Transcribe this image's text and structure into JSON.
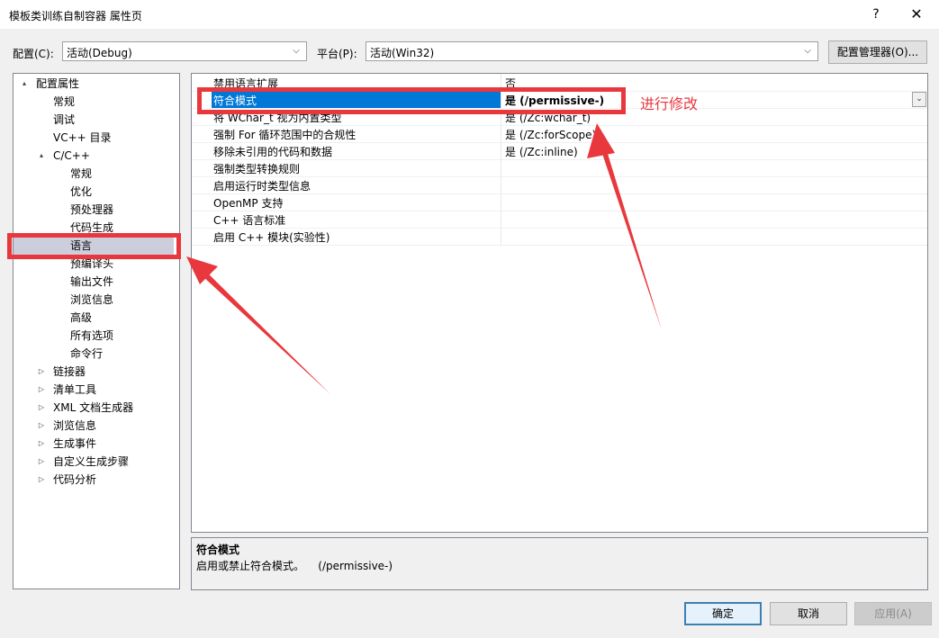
{
  "window": {
    "title": "模板类训练自制容器 属性页",
    "help_glyph": "?",
    "close_glyph": "✕"
  },
  "config_bar": {
    "config_label": "配置(C):",
    "config_value": "活动(Debug)",
    "platform_label": "平台(P):",
    "platform_value": "活动(Win32)",
    "manager_button": "配置管理器(O)..."
  },
  "tree": {
    "items": [
      {
        "label": "配置属性",
        "expand": "▴",
        "depth": 0
      },
      {
        "label": "常规",
        "depth": 1
      },
      {
        "label": "调试",
        "depth": 1
      },
      {
        "label": "VC++ 目录",
        "depth": 1
      },
      {
        "label": "C/C++",
        "expand": "▴",
        "depth": 1
      },
      {
        "label": "常规",
        "depth": 2
      },
      {
        "label": "优化",
        "depth": 2
      },
      {
        "label": "预处理器",
        "depth": 2
      },
      {
        "label": "代码生成",
        "depth": 2
      },
      {
        "label": "语言",
        "depth": 2,
        "selected": true
      },
      {
        "label": "预编译头",
        "depth": 2
      },
      {
        "label": "输出文件",
        "depth": 2
      },
      {
        "label": "浏览信息",
        "depth": 2
      },
      {
        "label": "高级",
        "depth": 2
      },
      {
        "label": "所有选项",
        "depth": 2
      },
      {
        "label": "命令行",
        "depth": 2
      },
      {
        "label": "链接器",
        "expand": "▷",
        "depth": 1
      },
      {
        "label": "清单工具",
        "expand": "▷",
        "depth": 1
      },
      {
        "label": "XML 文档生成器",
        "expand": "▷",
        "depth": 1
      },
      {
        "label": "浏览信息",
        "expand": "▷",
        "depth": 1
      },
      {
        "label": "生成事件",
        "expand": "▷",
        "depth": 1
      },
      {
        "label": "自定义生成步骤",
        "expand": "▷",
        "depth": 1
      },
      {
        "label": "代码分析",
        "expand": "▷",
        "depth": 1
      }
    ]
  },
  "properties": {
    "rows": [
      {
        "name": "禁用语言扩展",
        "value": "否"
      },
      {
        "name": "符合模式",
        "value": "是 (/permissive-)",
        "selected": true
      },
      {
        "name": "将 WChar_t 视为内置类型",
        "value": "是 (/Zc:wchar_t)"
      },
      {
        "name": "强制 For 循环范围中的合规性",
        "value": "是 (/Zc:forScope)"
      },
      {
        "name": "移除未引用的代码和数据",
        "value": "是 (/Zc:inline)"
      },
      {
        "name": "强制类型转换规则",
        "value": ""
      },
      {
        "name": "启用运行时类型信息",
        "value": ""
      },
      {
        "name": "OpenMP 支持",
        "value": ""
      },
      {
        "name": "C++ 语言标准",
        "value": ""
      },
      {
        "name": "启用 C++ 模块(实验性)",
        "value": ""
      }
    ],
    "dropdown_glyph": "⌄"
  },
  "description": {
    "title": "符合模式",
    "text": "启用或禁止符合模式。    (/permissive-)"
  },
  "annotation": {
    "text": "进行修改",
    "color": "#e8383d"
  },
  "buttons": {
    "ok": "确定",
    "cancel": "取消",
    "apply": "应用(A)"
  }
}
